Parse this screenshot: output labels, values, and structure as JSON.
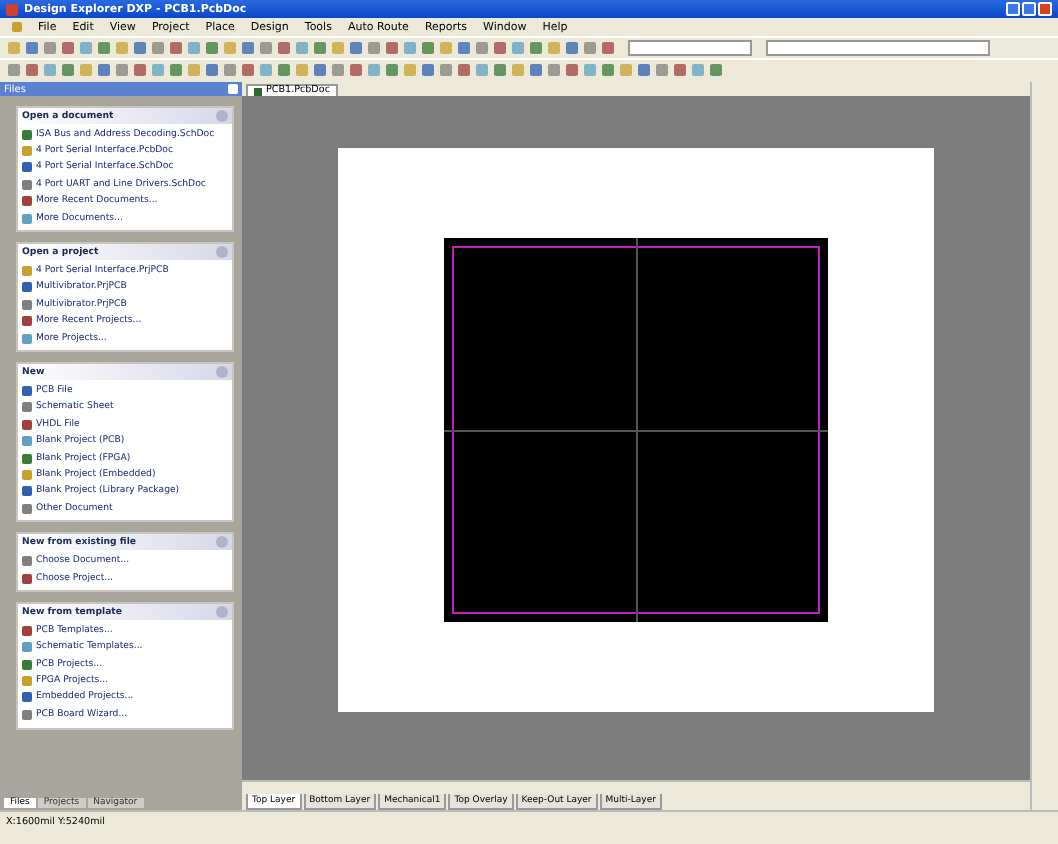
{
  "window": {
    "title": "Design Explorer DXP - PCB1.PcbDoc"
  },
  "menu": [
    "File",
    "Edit",
    "View",
    "Project",
    "Place",
    "Design",
    "Tools",
    "Auto Route",
    "Reports",
    "Window",
    "Help"
  ],
  "panel": {
    "title": "Files",
    "groups": [
      {
        "title": "Open a document",
        "items": [
          "ISA Bus and Address Decoding.SchDoc",
          "4 Port Serial Interface.PcbDoc",
          "4 Port Serial Interface.SchDoc",
          "4 Port UART and Line Drivers.SchDoc",
          "More Recent Documents...",
          "More Documents..."
        ]
      },
      {
        "title": "Open a project",
        "items": [
          "4 Port Serial Interface.PrjPCB",
          "Multivibrator.PrjPCB",
          "Multivibrator.PrjPCB",
          "More Recent Projects...",
          "More Projects..."
        ]
      },
      {
        "title": "New",
        "items": [
          "PCB File",
          "Schematic Sheet",
          "VHDL File",
          "Blank Project (PCB)",
          "Blank Project (FPGA)",
          "Blank Project (Embedded)",
          "Blank Project (Library Package)",
          "Other Document"
        ]
      },
      {
        "title": "New from existing file",
        "items": [
          "Choose Document...",
          "Choose Project..."
        ]
      },
      {
        "title": "New from template",
        "items": [
          "PCB Templates...",
          "Schematic Templates...",
          "PCB Projects...",
          "FPGA Projects...",
          "Embedded Projects...",
          "PCB Board Wizard..."
        ]
      }
    ],
    "tabs": [
      {
        "label": "Files",
        "selected": true
      },
      {
        "label": "Projects",
        "selected": false
      },
      {
        "label": "Navigator",
        "selected": false
      }
    ]
  },
  "document_tab": {
    "label": "PCB1.PcbDoc"
  },
  "layer_tabs": [
    {
      "label": "Top Layer",
      "selected": true
    },
    {
      "label": "Bottom Layer",
      "selected": false
    },
    {
      "label": "Mechanical1",
      "selected": false
    },
    {
      "label": "Top Overlay",
      "selected": false
    },
    {
      "label": "Keep-Out Layer",
      "selected": false
    },
    {
      "label": "Multi-Layer",
      "selected": false
    }
  ],
  "status_bar": {
    "coordinates": "X:1600mil Y:5240mil"
  }
}
